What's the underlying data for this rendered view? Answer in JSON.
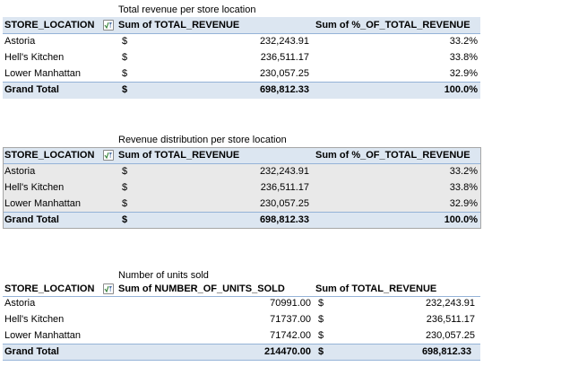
{
  "tables": [
    {
      "caption": "Total revenue per store location",
      "headers": [
        "STORE_LOCATION",
        "Sum of TOTAL_REVENUE",
        "Sum of %_OF_TOTAL_REVENUE"
      ],
      "rows": [
        {
          "label": "Astoria",
          "cur": "$",
          "v1": "232,243.91",
          "v2": "33.2%"
        },
        {
          "label": "Hell's Kitchen",
          "cur": "$",
          "v1": "236,511.17",
          "v2": "33.8%"
        },
        {
          "label": "Lower Manhattan",
          "cur": "$",
          "v1": "230,057.25",
          "v2": "32.9%"
        }
      ],
      "total": {
        "label": "Grand Total",
        "cur": "$",
        "v1": "698,812.33",
        "v2": "100.0%"
      }
    },
    {
      "caption": "Revenue distribution per store location",
      "headers": [
        "STORE_LOCATION",
        "Sum of TOTAL_REVENUE",
        "Sum of %_OF_TOTAL_REVENUE"
      ],
      "rows": [
        {
          "label": "Astoria",
          "cur": "$",
          "v1": "232,243.91",
          "v2": "33.2%"
        },
        {
          "label": "Hell's Kitchen",
          "cur": "$",
          "v1": "236,511.17",
          "v2": "33.8%"
        },
        {
          "label": "Lower Manhattan",
          "cur": "$",
          "v1": "230,057.25",
          "v2": "32.9%"
        }
      ],
      "total": {
        "label": "Grand Total",
        "cur": "$",
        "v1": "698,812.33",
        "v2": "100.0%"
      }
    },
    {
      "caption": "Number of units sold",
      "headers": [
        "STORE_LOCATION",
        "Sum of NUMBER_OF_UNITS_SOLD",
        "Sum of TOTAL_REVENUE"
      ],
      "rows": [
        {
          "label": "Astoria",
          "v1": "70991.00",
          "cur": "$",
          "v2": "232,243.91"
        },
        {
          "label": "Hell's Kitchen",
          "v1": "71737.00",
          "cur": "$",
          "v2": "236,511.17"
        },
        {
          "label": "Lower Manhattan",
          "v1": "71742.00",
          "cur": "$",
          "v2": "230,057.25"
        }
      ],
      "total": {
        "label": "Grand Total",
        "v1": "214470.00",
        "cur": "$",
        "v2": "698,812.33"
      }
    }
  ],
  "colors": {
    "header_fill": "#dce6f1",
    "header_border": "#95b3d7",
    "shaded_fill": "#e9e9e9"
  },
  "icons": {
    "filter": "filter-dropdown-icon"
  }
}
